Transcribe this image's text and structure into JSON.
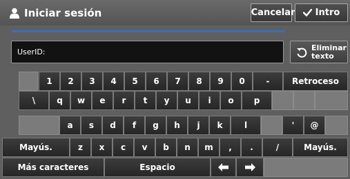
{
  "header": {
    "title": "Iniciar sesión",
    "cancel_label": "Cancelar",
    "enter_label": "Intro"
  },
  "input": {
    "label": "UserID:",
    "value": ""
  },
  "erase_button": {
    "label": "Eliminar\ntexto"
  },
  "keyboard": {
    "row1": [
      "1",
      "2",
      "3",
      "4",
      "5",
      "6",
      "7",
      "8",
      "9",
      "0",
      "-"
    ],
    "backspace": "Retroceso",
    "row2": [
      "\\",
      "q",
      "w",
      "e",
      "r",
      "t",
      "y",
      "u",
      "i",
      "o",
      "p"
    ],
    "row3": [
      "a",
      "s",
      "d",
      "f",
      "g",
      "h",
      "j",
      "k",
      "l"
    ],
    "row3_extra": [
      "'",
      "@"
    ],
    "shift_left": "Mayús.",
    "row4": [
      "z",
      "x",
      "c",
      "v",
      "b",
      "n",
      "m",
      ",",
      ".",
      "/"
    ],
    "shift_right": "Mayús.",
    "more_chars": "Más caracteres",
    "space": "Espacio"
  },
  "colors": {
    "background": "#5f5f5f",
    "accent_line": "#3a6fb5",
    "key_face": "#303030",
    "blank_key": "#7b7b7b"
  }
}
